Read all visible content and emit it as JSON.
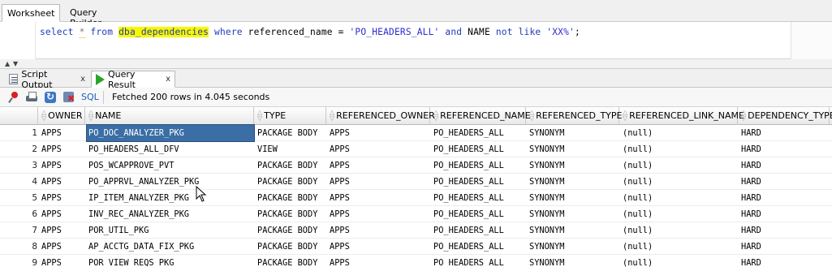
{
  "worksheet_tabs": [
    "Worksheet",
    "Query Builder"
  ],
  "editor": {
    "tokens": [
      {
        "t": "select",
        "c": "kw"
      },
      {
        "t": " "
      },
      {
        "t": "*",
        "c": "star"
      },
      {
        "t": " "
      },
      {
        "t": "from",
        "c": "kw"
      },
      {
        "t": " "
      },
      {
        "t": "dba_dependencies",
        "c": "hl"
      },
      {
        "t": " "
      },
      {
        "t": "where",
        "c": "kw"
      },
      {
        "t": " referenced_name = "
      },
      {
        "t": "'PO_HEADERS_ALL'",
        "c": "str"
      },
      {
        "t": " "
      },
      {
        "t": "and",
        "c": "kw"
      },
      {
        "t": " NAME "
      },
      {
        "t": "not",
        "c": "kw"
      },
      {
        "t": " "
      },
      {
        "t": "like",
        "c": "kw"
      },
      {
        "t": " "
      },
      {
        "t": "'XX%'",
        "c": "str"
      },
      {
        "t": ";"
      }
    ]
  },
  "result_tabs": {
    "script_output": "Script Output",
    "query_result": "Query Result",
    "close": "x"
  },
  "toolbar": {
    "sql_label": "SQL",
    "separator": "|",
    "status": "Fetched 200 rows in 4.045 seconds"
  },
  "grid": {
    "columns": [
      "OWNER",
      "NAME",
      "TYPE",
      "REFERENCED_OWNER",
      "REFERENCED_NAME",
      "REFERENCED_TYPE",
      "REFERENCED_LINK_NAME",
      "DEPENDENCY_TYPE"
    ],
    "selected_cell": {
      "row": 0,
      "col": 1
    },
    "rows": [
      {
        "n": "1",
        "c": [
          "APPS",
          "PO_DOC_ANALYZER_PKG",
          "PACKAGE BODY",
          "APPS",
          "PO_HEADERS_ALL",
          "SYNONYM",
          "(null)",
          "HARD"
        ]
      },
      {
        "n": "2",
        "c": [
          "APPS",
          "PO_HEADERS_ALL_DFV",
          "VIEW",
          "APPS",
          "PO_HEADERS_ALL",
          "SYNONYM",
          "(null)",
          "HARD"
        ]
      },
      {
        "n": "3",
        "c": [
          "APPS",
          "POS_WCAPPROVE_PVT",
          "PACKAGE BODY",
          "APPS",
          "PO_HEADERS_ALL",
          "SYNONYM",
          "(null)",
          "HARD"
        ]
      },
      {
        "n": "4",
        "c": [
          "APPS",
          "PO_APPRVL_ANALYZER_PKG",
          "PACKAGE BODY",
          "APPS",
          "PO_HEADERS_ALL",
          "SYNONYM",
          "(null)",
          "HARD"
        ]
      },
      {
        "n": "5",
        "c": [
          "APPS",
          "IP_ITEM_ANALYZER_PKG",
          "PACKAGE BODY",
          "APPS",
          "PO_HEADERS_ALL",
          "SYNONYM",
          "(null)",
          "HARD"
        ]
      },
      {
        "n": "6",
        "c": [
          "APPS",
          "INV_REC_ANALYZER_PKG",
          "PACKAGE BODY",
          "APPS",
          "PO_HEADERS_ALL",
          "SYNONYM",
          "(null)",
          "HARD"
        ]
      },
      {
        "n": "7",
        "c": [
          "APPS",
          "POR_UTIL_PKG",
          "PACKAGE BODY",
          "APPS",
          "PO_HEADERS_ALL",
          "SYNONYM",
          "(null)",
          "HARD"
        ]
      },
      {
        "n": "8",
        "c": [
          "APPS",
          "AP_ACCTG_DATA_FIX_PKG",
          "PACKAGE BODY",
          "APPS",
          "PO_HEADERS_ALL",
          "SYNONYM",
          "(null)",
          "HARD"
        ]
      },
      {
        "n": "9",
        "c": [
          "APPS",
          "POR_VIEW_REQS_PKG",
          "PACKAGE BODY",
          "APPS",
          "PO_HEADERS_ALL",
          "SYNONYM",
          "(null)",
          "HARD"
        ]
      }
    ]
  },
  "colors": {
    "keyword": "#1f3bbd",
    "highlight": "#f7f700",
    "selection": "#3b6ea5",
    "run_icon": "#2aa52a"
  },
  "icons": [
    "pin-icon",
    "print-icon",
    "refresh-icon",
    "clear-icon",
    "script-output-icon",
    "run-icon",
    "sort-icon",
    "mouse-cursor-icon"
  ]
}
